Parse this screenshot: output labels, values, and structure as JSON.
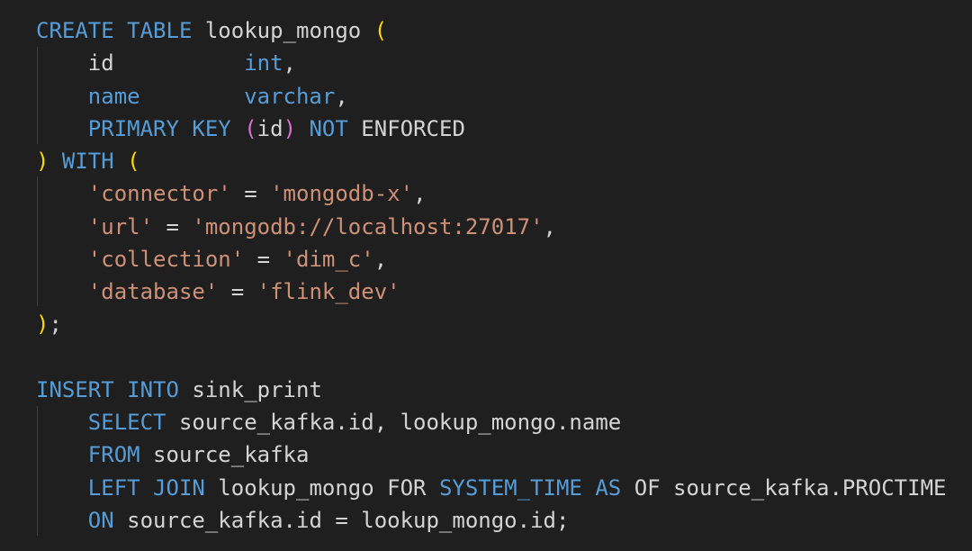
{
  "colors": {
    "background": "#1f1f1f",
    "keyword": "#569cd6",
    "text": "#d4d4d4",
    "string": "#ce9178",
    "bracket_level1": "#ffd700",
    "bracket_level2": "#da70d6",
    "indent_guide": "#404040"
  },
  "code": {
    "lines": [
      [
        {
          "t": "CREATE",
          "c": "kw"
        },
        {
          "t": " ",
          "c": "tx"
        },
        {
          "t": "TABLE",
          "c": "kw"
        },
        {
          "t": " lookup_mongo ",
          "c": "tx"
        },
        {
          "t": "(",
          "c": "p1"
        }
      ],
      [
        {
          "t": "    id          ",
          "c": "tx"
        },
        {
          "t": "int",
          "c": "kw"
        },
        {
          "t": ",",
          "c": "tx"
        }
      ],
      [
        {
          "t": "    ",
          "c": "tx"
        },
        {
          "t": "name",
          "c": "kw"
        },
        {
          "t": "        ",
          "c": "tx"
        },
        {
          "t": "varchar",
          "c": "kw"
        },
        {
          "t": ",",
          "c": "tx"
        }
      ],
      [
        {
          "t": "    ",
          "c": "tx"
        },
        {
          "t": "PRIMARY",
          "c": "kw"
        },
        {
          "t": " ",
          "c": "tx"
        },
        {
          "t": "KEY",
          "c": "kw"
        },
        {
          "t": " ",
          "c": "tx"
        },
        {
          "t": "(",
          "c": "p2"
        },
        {
          "t": "id",
          "c": "tx"
        },
        {
          "t": ")",
          "c": "p2"
        },
        {
          "t": " ",
          "c": "tx"
        },
        {
          "t": "NOT",
          "c": "kw"
        },
        {
          "t": " ENFORCED",
          "c": "tx"
        }
      ],
      [
        {
          "t": ")",
          "c": "p1"
        },
        {
          "t": " ",
          "c": "tx"
        },
        {
          "t": "WITH",
          "c": "kw"
        },
        {
          "t": " ",
          "c": "tx"
        },
        {
          "t": "(",
          "c": "p1"
        }
      ],
      [
        {
          "t": "    ",
          "c": "tx"
        },
        {
          "t": "'connector'",
          "c": "str"
        },
        {
          "t": " = ",
          "c": "tx"
        },
        {
          "t": "'mongodb-x'",
          "c": "str"
        },
        {
          "t": ",",
          "c": "tx"
        }
      ],
      [
        {
          "t": "    ",
          "c": "tx"
        },
        {
          "t": "'url'",
          "c": "str"
        },
        {
          "t": " = ",
          "c": "tx"
        },
        {
          "t": "'mongodb://localhost:27017'",
          "c": "str"
        },
        {
          "t": ",",
          "c": "tx"
        }
      ],
      [
        {
          "t": "    ",
          "c": "tx"
        },
        {
          "t": "'collection'",
          "c": "str"
        },
        {
          "t": " = ",
          "c": "tx"
        },
        {
          "t": "'dim_c'",
          "c": "str"
        },
        {
          "t": ",",
          "c": "tx"
        }
      ],
      [
        {
          "t": "    ",
          "c": "tx"
        },
        {
          "t": "'database'",
          "c": "str"
        },
        {
          "t": " = ",
          "c": "tx"
        },
        {
          "t": "'flink_dev'",
          "c": "str"
        }
      ],
      [
        {
          "t": ")",
          "c": "p1"
        },
        {
          "t": ";",
          "c": "tx"
        }
      ],
      [],
      [
        {
          "t": "INSERT",
          "c": "kw"
        },
        {
          "t": " ",
          "c": "tx"
        },
        {
          "t": "INTO",
          "c": "kw"
        },
        {
          "t": " sink_print",
          "c": "tx"
        }
      ],
      [
        {
          "t": "    ",
          "c": "tx"
        },
        {
          "t": "SELECT",
          "c": "kw"
        },
        {
          "t": " source_kafka.id, lookup_mongo.name",
          "c": "tx"
        }
      ],
      [
        {
          "t": "    ",
          "c": "tx"
        },
        {
          "t": "FROM",
          "c": "kw"
        },
        {
          "t": " source_kafka",
          "c": "tx"
        }
      ],
      [
        {
          "t": "    ",
          "c": "tx"
        },
        {
          "t": "LEFT",
          "c": "kw"
        },
        {
          "t": " ",
          "c": "tx"
        },
        {
          "t": "JOIN",
          "c": "kw"
        },
        {
          "t": " lookup_mongo FOR ",
          "c": "tx"
        },
        {
          "t": "SYSTEM_TIME",
          "c": "kw"
        },
        {
          "t": " ",
          "c": "tx"
        },
        {
          "t": "AS",
          "c": "kw"
        },
        {
          "t": " OF source_kafka.PROCTIME",
          "c": "tx"
        }
      ],
      [
        {
          "t": "    ",
          "c": "tx"
        },
        {
          "t": "ON",
          "c": "kw"
        },
        {
          "t": " source_kafka.id = lookup_mongo.id;",
          "c": "tx"
        }
      ]
    ]
  }
}
